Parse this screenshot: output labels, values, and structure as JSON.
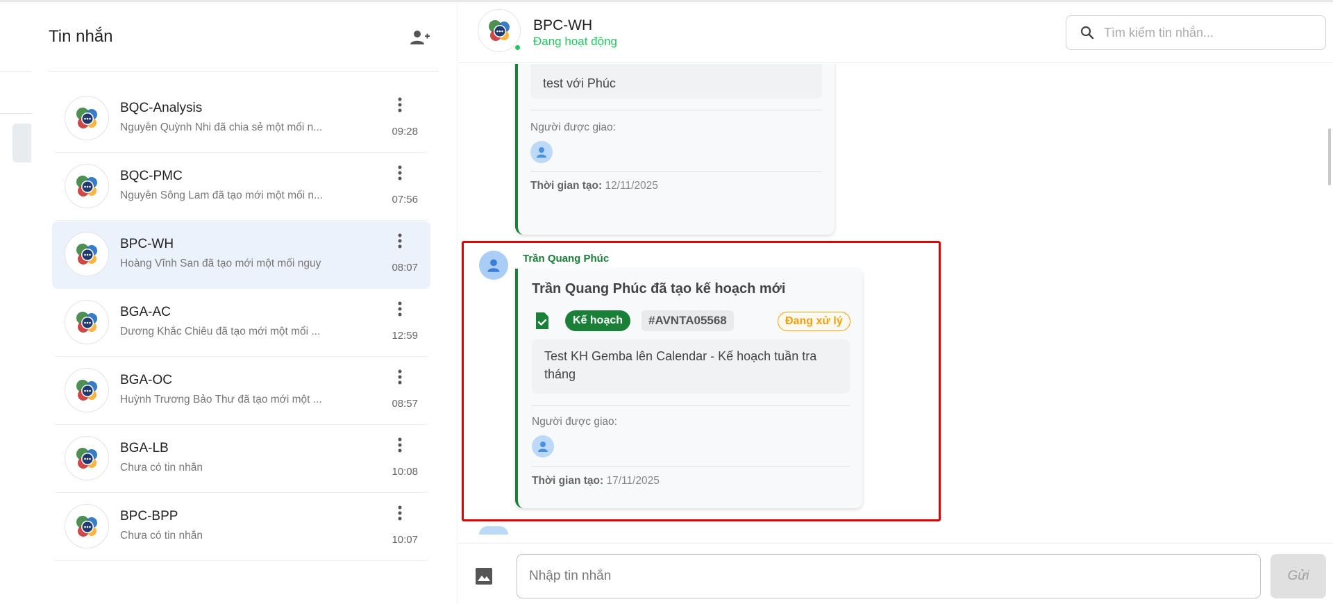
{
  "sidebar": {
    "title": "Tin nhắn",
    "conversations": [
      {
        "name": "BQC-Analysis",
        "preview": "Nguyễn Quỳnh Nhi đã chia sẻ một mối n...",
        "time": "09:28"
      },
      {
        "name": "BQC-PMC",
        "preview": "Nguyễn Sông Lam đã tạo mới một mối n...",
        "time": "07:56"
      },
      {
        "name": "BPC-WH",
        "preview": "Hoàng Vĩnh San đã tạo mới một mối nguy",
        "time": "08:07"
      },
      {
        "name": "BGA-AC",
        "preview": "Dương Khắc Chiêu đã tạo mới một mối ...",
        "time": "12:59"
      },
      {
        "name": "BGA-OC",
        "preview": "Huỳnh Trương Bảo Thư đã tạo mới một ...",
        "time": "08:57"
      },
      {
        "name": "BGA-LB",
        "preview": "Chưa có tin nhắn",
        "time": "10:08"
      },
      {
        "name": "BPC-BPP",
        "preview": "Chưa có tin nhắn",
        "time": "10:07"
      }
    ]
  },
  "chat": {
    "name": "BPC-WH",
    "status": "Đang hoạt động",
    "search_placeholder": "Tìm kiếm tin nhắn...",
    "messages": [
      {
        "body": "test với Phúc",
        "assignee_label": "Người được giao:",
        "created_label": "Thời gian tạo:",
        "created_date": "12/11/2025"
      },
      {
        "sender": "Trần Quang Phúc",
        "title": "Trần Quang Phúc đã tạo kế hoạch mới",
        "type_tag": "Kế hoạch",
        "code": "#AVNTA05568",
        "status": "Đang xử lý",
        "body": "Test KH Gemba lên Calendar - Kế hoạch tuần tra tháng",
        "assignee_label": "Người được giao:",
        "created_label": "Thời gian tạo:",
        "created_date": "17/11/2025"
      }
    ],
    "composer": {
      "placeholder": "Nhập tin nhắn",
      "send_label": "Gửi"
    }
  },
  "colors": {
    "accent_green": "#1a7f37",
    "online_green": "#22c55e",
    "status_orange": "#f59e0b",
    "highlight_red": "#e00000",
    "active_item_bg": "#ecf2fb"
  }
}
